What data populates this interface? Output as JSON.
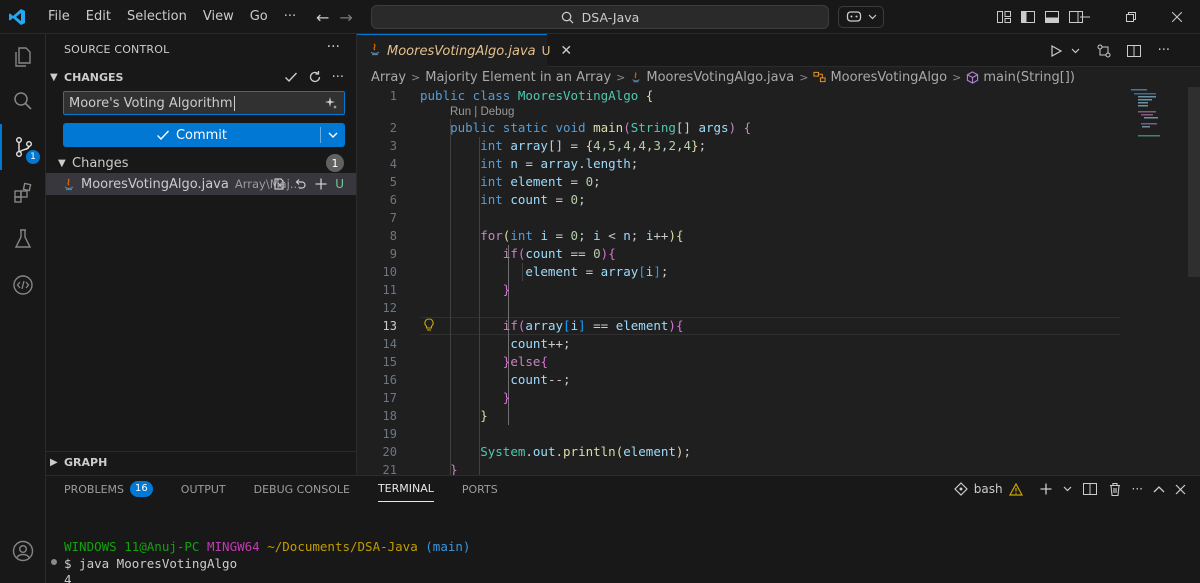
{
  "titlebar": {
    "menu": [
      "File",
      "Edit",
      "Selection",
      "View",
      "Go",
      "···"
    ],
    "search_text": "DSA-Java"
  },
  "activity": {
    "scm_badge": "1"
  },
  "sidebar": {
    "title": "SOURCE CONTROL",
    "section": "CHANGES",
    "commit_message": "Moore's Voting Algorithm",
    "commit_label": "Commit",
    "changes_label": "Changes",
    "changes_count": "1",
    "file": {
      "name": "MooresVotingAlgo.java",
      "path": "Array\\Maj...",
      "status": "U"
    },
    "graph_label": "GRAPH"
  },
  "editor": {
    "tab": {
      "name": "MooresVotingAlgo.java",
      "status": "U"
    },
    "breadcrumb": [
      "Array",
      "Majority Element in an Array",
      "MooresVotingAlgo.java",
      "MooresVotingAlgo",
      "main(String[])"
    ],
    "codelens": "Run | Debug",
    "line_numbers": [
      "1",
      "2",
      "3",
      "4",
      "5",
      "6",
      "7",
      "8",
      "9",
      "10",
      "11",
      "12",
      "13",
      "14",
      "15",
      "16",
      "17",
      "18",
      "19",
      "20",
      "21"
    ],
    "active_line": "13"
  },
  "panel": {
    "tabs": [
      "PROBLEMS",
      "OUTPUT",
      "DEBUG CONSOLE",
      "TERMINAL",
      "PORTS"
    ],
    "problems_count": "16",
    "shell_name": "bash",
    "terminal": {
      "user_host": "WINDOWS 11@Anuj-PC",
      "system": "MINGW64",
      "path": "~/Documents/DSA-Java",
      "branch": "(main)",
      "command": "$ java MooresVotingAlgo",
      "output": "4"
    }
  },
  "colors": {
    "accent": "#0078d4",
    "untracked": "#73c991",
    "modified_tab": "#e2c08d"
  }
}
